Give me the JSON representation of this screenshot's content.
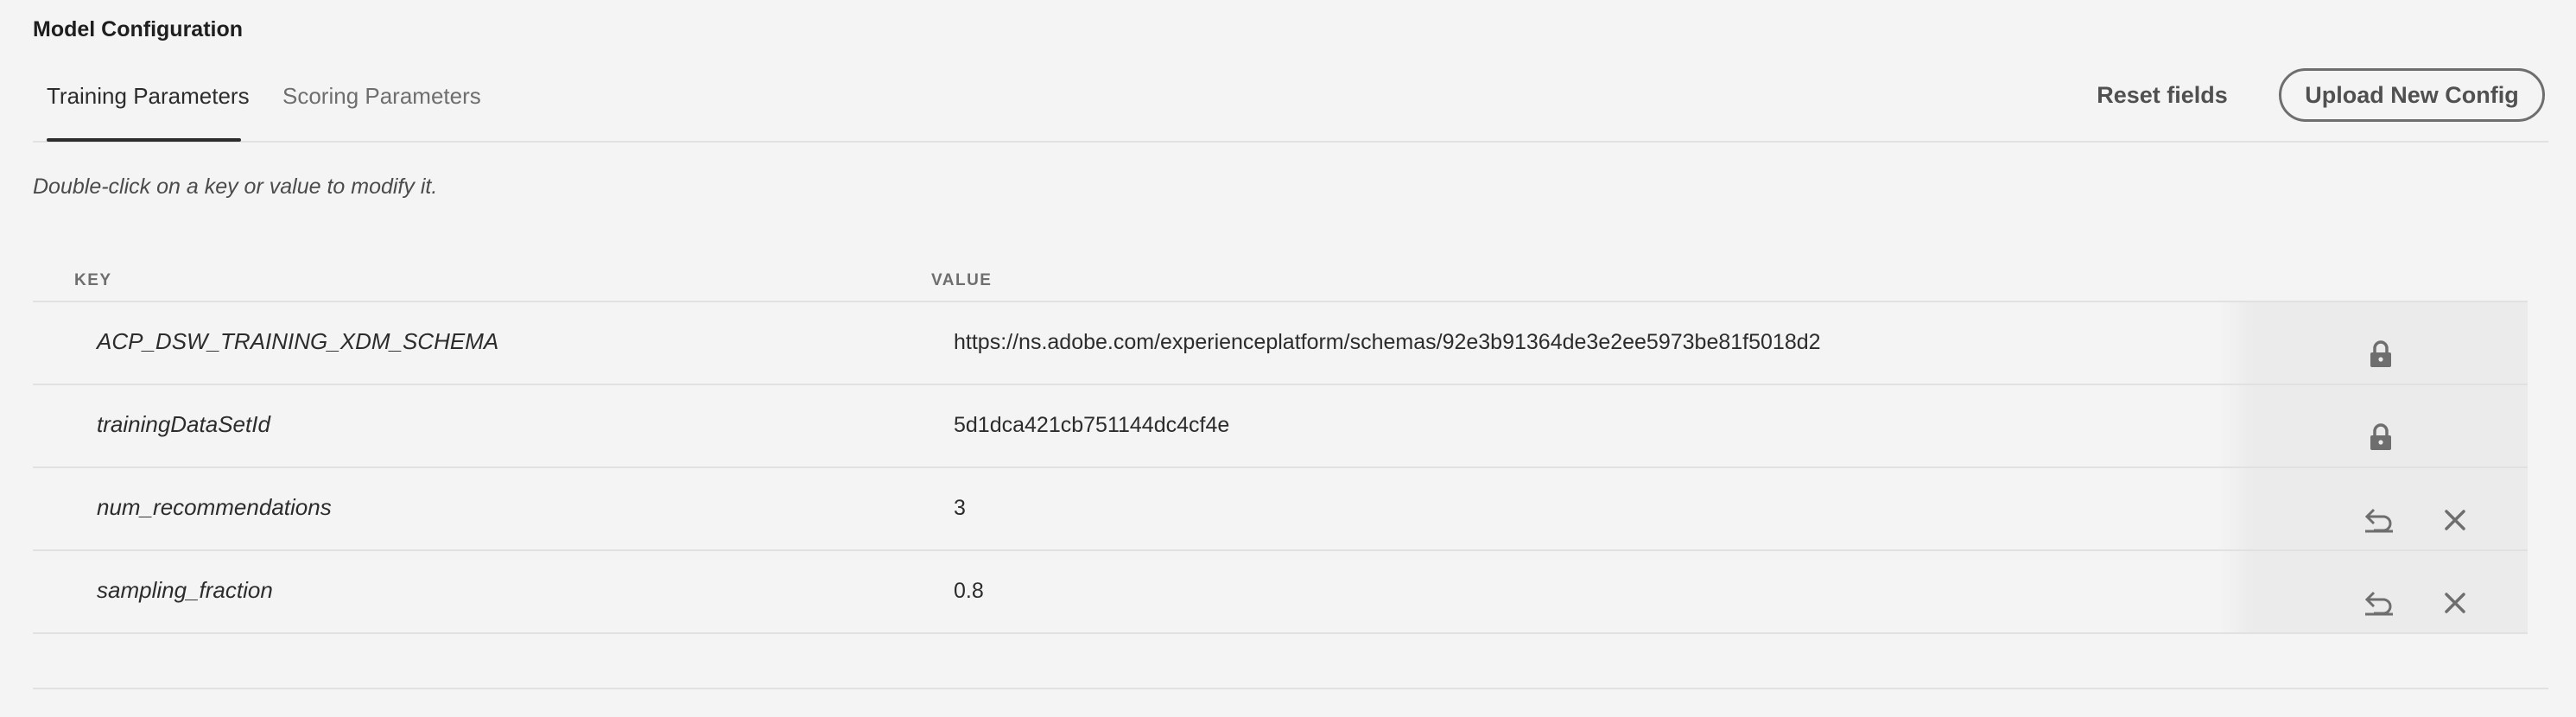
{
  "page": {
    "title": "Model Configuration",
    "hint": "Double-click on a key or value to modify it."
  },
  "tabs": [
    {
      "label": "Training Parameters",
      "active": true
    },
    {
      "label": "Scoring Parameters",
      "active": false
    }
  ],
  "actions": {
    "reset_label": "Reset fields",
    "upload_label": "Upload New Config"
  },
  "table": {
    "headers": {
      "key": "KEY",
      "value": "VALUE"
    },
    "rows": [
      {
        "key": "ACP_DSW_TRAINING_XDM_SCHEMA",
        "value": "https://ns.adobe.com/experienceplatform/schemas/92e3b91364de3e2ee5973be81f5018d2",
        "icons": [
          "lock-icon"
        ]
      },
      {
        "key": "trainingDataSetId",
        "value": "5d1dca421cb751144dc4cf4e",
        "icons": [
          "lock-icon"
        ]
      },
      {
        "key": "num_recommendations",
        "value": "3",
        "icons": [
          "undo-icon",
          "close-icon"
        ]
      },
      {
        "key": "sampling_fraction",
        "value": "0.8",
        "icons": [
          "undo-icon",
          "close-icon"
        ]
      }
    ]
  },
  "colors": {
    "background": "#f4f4f4",
    "text": "#2c2c2c",
    "muted": "#6e6e6e",
    "divider": "#e1e1e1",
    "action_column": "#ebebeb"
  }
}
